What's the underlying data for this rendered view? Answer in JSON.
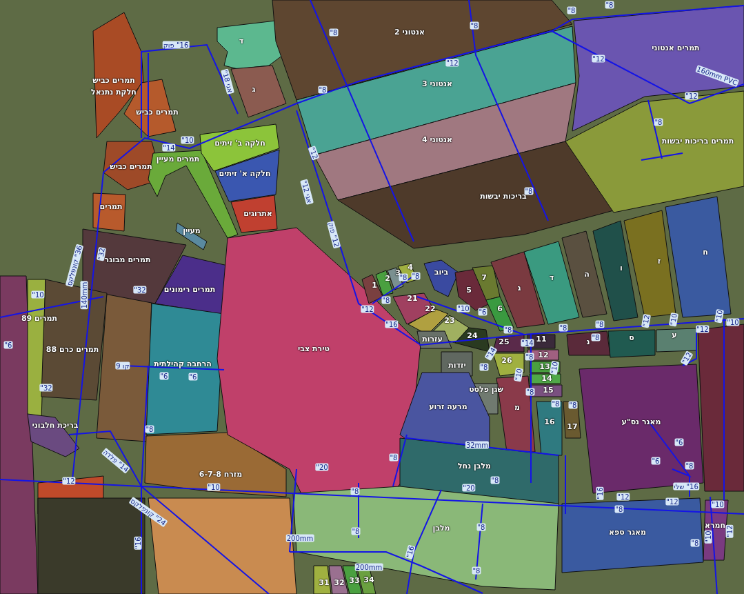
{
  "map": {
    "parcels": [
      {
        "label": "ד",
        "color": "#5cb88f"
      },
      {
        "label": "ג",
        "color": "#8b5b50"
      },
      {
        "label": "תמרים כביש",
        "sublabel": "חלקת נתנאל",
        "color": "#a94b25"
      },
      {
        "label": "תמרים כביש",
        "color": "#b55a2c"
      },
      {
        "label": "תמרים כביש",
        "color": "#9e4a28"
      },
      {
        "label": "תמרים מעיין",
        "color": "#6aaa3a"
      },
      {
        "label": "חלקה ב' זיתים",
        "color": "#8cc43a"
      },
      {
        "label": "חלקה א' זיתים",
        "color": "#3a57b0"
      },
      {
        "label": "אתרוגים",
        "color": "#c04030"
      },
      {
        "label": "תמרים",
        "color": "#b85a2c"
      },
      {
        "label": "מעיין",
        "color": "#5a8aa0"
      },
      {
        "label": "תמרים מבוגר",
        "color": "#54393c"
      },
      {
        "label": "תמרים רימונים",
        "color": "#4b2e8a"
      },
      {
        "label": "אנטוני 2",
        "color": "#5e4630"
      },
      {
        "label": "אנטוני 3",
        "color": "#4aa393"
      },
      {
        "label": "אנטוני 4",
        "color": "#a07880"
      },
      {
        "label": "בריכות יבשות",
        "color": "#4e3a2a"
      },
      {
        "label": "תמרים אנטוני",
        "color": "#6a55b0"
      },
      {
        "label": "תמרים בריכות יבשות",
        "color": "#8a9a3a"
      },
      {
        "label": "תמרים 89",
        "color": "#9ab040"
      },
      {
        "label": "תמרים כרם 88",
        "color": "#5b4a35"
      },
      {
        "label": "הרחבה קהילתית",
        "color": "#2f8a95"
      },
      {
        "label": "בריכת חלבוני",
        "color": "#6a4a80"
      },
      {
        "label": "מזרח 6-7-8",
        "color": "#9a6a35"
      },
      {
        "label": "טירת צבי",
        "color": "#c0406a"
      },
      {
        "label": "1",
        "color": "#7a4040"
      },
      {
        "label": "2",
        "color": "#4aa040"
      },
      {
        "label": "3",
        "color": "#7a9090"
      },
      {
        "label": "4",
        "color": "#a0b040"
      },
      {
        "label": "ביוב",
        "color": "#3a4aa0"
      },
      {
        "label": "5",
        "color": "#6a2a3a"
      },
      {
        "label": "7",
        "color": "#6a7a30"
      },
      {
        "label": "6",
        "color": "#3a9a40"
      },
      {
        "label": "21",
        "color": "#a04060"
      },
      {
        "label": "22",
        "color": "#b0a040"
      },
      {
        "label": "23",
        "color": "#a0b060"
      },
      {
        "label": "24",
        "color": "#2a3a20"
      },
      {
        "label": "ג",
        "color": "#7a3a40"
      },
      {
        "label": "ד",
        "color": "#3a9a80"
      },
      {
        "label": "ה",
        "color": "#5a5040"
      },
      {
        "label": "ו",
        "color": "#20504a"
      },
      {
        "label": "ז",
        "color": "#7a7020"
      },
      {
        "label": "ח",
        "color": "#3a5aa0"
      },
      {
        "label": "25",
        "color": "#5a2a4a"
      },
      {
        "label": "26",
        "color": "#a0b040"
      },
      {
        "label": "11",
        "color": "#3a2a3a"
      },
      {
        "label": "12",
        "color": "#a06080"
      },
      {
        "label": "13",
        "color": "#4aa040"
      },
      {
        "label": "14",
        "color": "#50a848"
      },
      {
        "label": "15",
        "color": "#7a5080"
      },
      {
        "label": "16",
        "color": "#2f7a80"
      },
      {
        "label": "17",
        "color": "#6a5a30"
      },
      {
        "label": "מ",
        "color": "#8a3a4a"
      },
      {
        "label": "שגן פלסט",
        "color": "#707a70"
      },
      {
        "label": "עזרות",
        "color": "#687068"
      },
      {
        "label": "יזדות",
        "color": "#606860"
      },
      {
        "label": "מרעה זרוע",
        "color": "#4a55a0"
      },
      {
        "label": "נ",
        "color": "#5a2a3a"
      },
      {
        "label": "ס",
        "color": "#205a50"
      },
      {
        "label": "ע",
        "color": "#5a8070"
      },
      {
        "label": "מאגר נס\"ע",
        "color": "#6a2a6a"
      },
      {
        "label": "מאגר ספא",
        "color": "#3a5aa0"
      },
      {
        "label": "חמרא",
        "color": "#7a3a80"
      },
      {
        "label": "מלבן נחל",
        "color": "#2f6a6a"
      },
      {
        "label": "מלבן",
        "color": "#8ab878"
      },
      {
        "label": "34",
        "color": "#6aa040"
      },
      {
        "label": "33",
        "color": "#4aa040"
      },
      {
        "label": "32",
        "color": "#9a7090"
      },
      {
        "label": "31",
        "color": "#a0b040"
      }
    ],
    "pipe_labels": [
      "16\" פוק",
      "אגי 18\"",
      "14\"",
      "10\"",
      "32\"",
      "36\" קונפלקס",
      "140mm",
      "32\"",
      "10\"",
      "6\"",
      "32\"",
      "קו 9",
      "6\"",
      "6\"",
      "8\"",
      "14\" פלדה",
      "12\"",
      "10\"",
      "24\" קונפלקס",
      "16\"",
      "20\"",
      "8\"",
      "8\"",
      "8\"",
      "32mm",
      "8\"",
      "20\"",
      "8\"",
      "16\"",
      "200mm",
      "200mm",
      "8\"",
      "8\"",
      "8\"",
      "12\"",
      "8\"",
      "12\"",
      "אגי 12\"",
      "12\" פוק",
      "8\"",
      "8\"",
      "12\"",
      "160mm PVC",
      "12\"",
      "8\"",
      "8\"",
      "12\"",
      "16\"",
      "8\"",
      "8\"",
      "8\"",
      "10\"",
      "6\"",
      "8\"",
      "14\"",
      "8\"",
      "14\"",
      "8\"",
      "10\"",
      "10\"",
      "8\"",
      "8\"",
      "8\"",
      "8\"",
      "8\"",
      "8\"",
      "12\"",
      "10\"",
      "10\"",
      "10\"",
      "12\"",
      "12\"",
      "6\"",
      "6\"",
      "8\"",
      "16\" שלי",
      "16\"",
      "12\"",
      "12\"",
      "8\"",
      "10\"",
      "10\"",
      "12\"",
      "8\""
    ]
  }
}
